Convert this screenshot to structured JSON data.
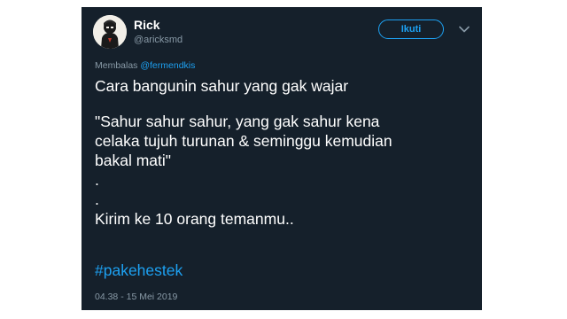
{
  "tweet": {
    "author_name": "Rick",
    "author_handle": "@aricksmd",
    "follow_label": "Ikuti",
    "reply_prefix": "Membalas",
    "reply_to": "@fermendkis",
    "lines": [
      "Cara bangunin sahur yang gak wajar",
      "\"Sahur sahur sahur, yang gak sahur kena",
      "celaka tujuh turunan & seminggu kemudian",
      "bakal mati\"",
      ".",
      ".",
      "Kirim ke 10 orang temanmu.."
    ],
    "hashtag": "#pakehestek",
    "timestamp": "04.38 - 15 Mei 2019"
  },
  "icons": {
    "avatar": "avatar",
    "menu": "chevron-down-icon"
  },
  "colors": {
    "background": "#15202b",
    "accent": "#1da1f2",
    "secondary_text": "#8899a6",
    "primary_text": "#ffffff"
  }
}
